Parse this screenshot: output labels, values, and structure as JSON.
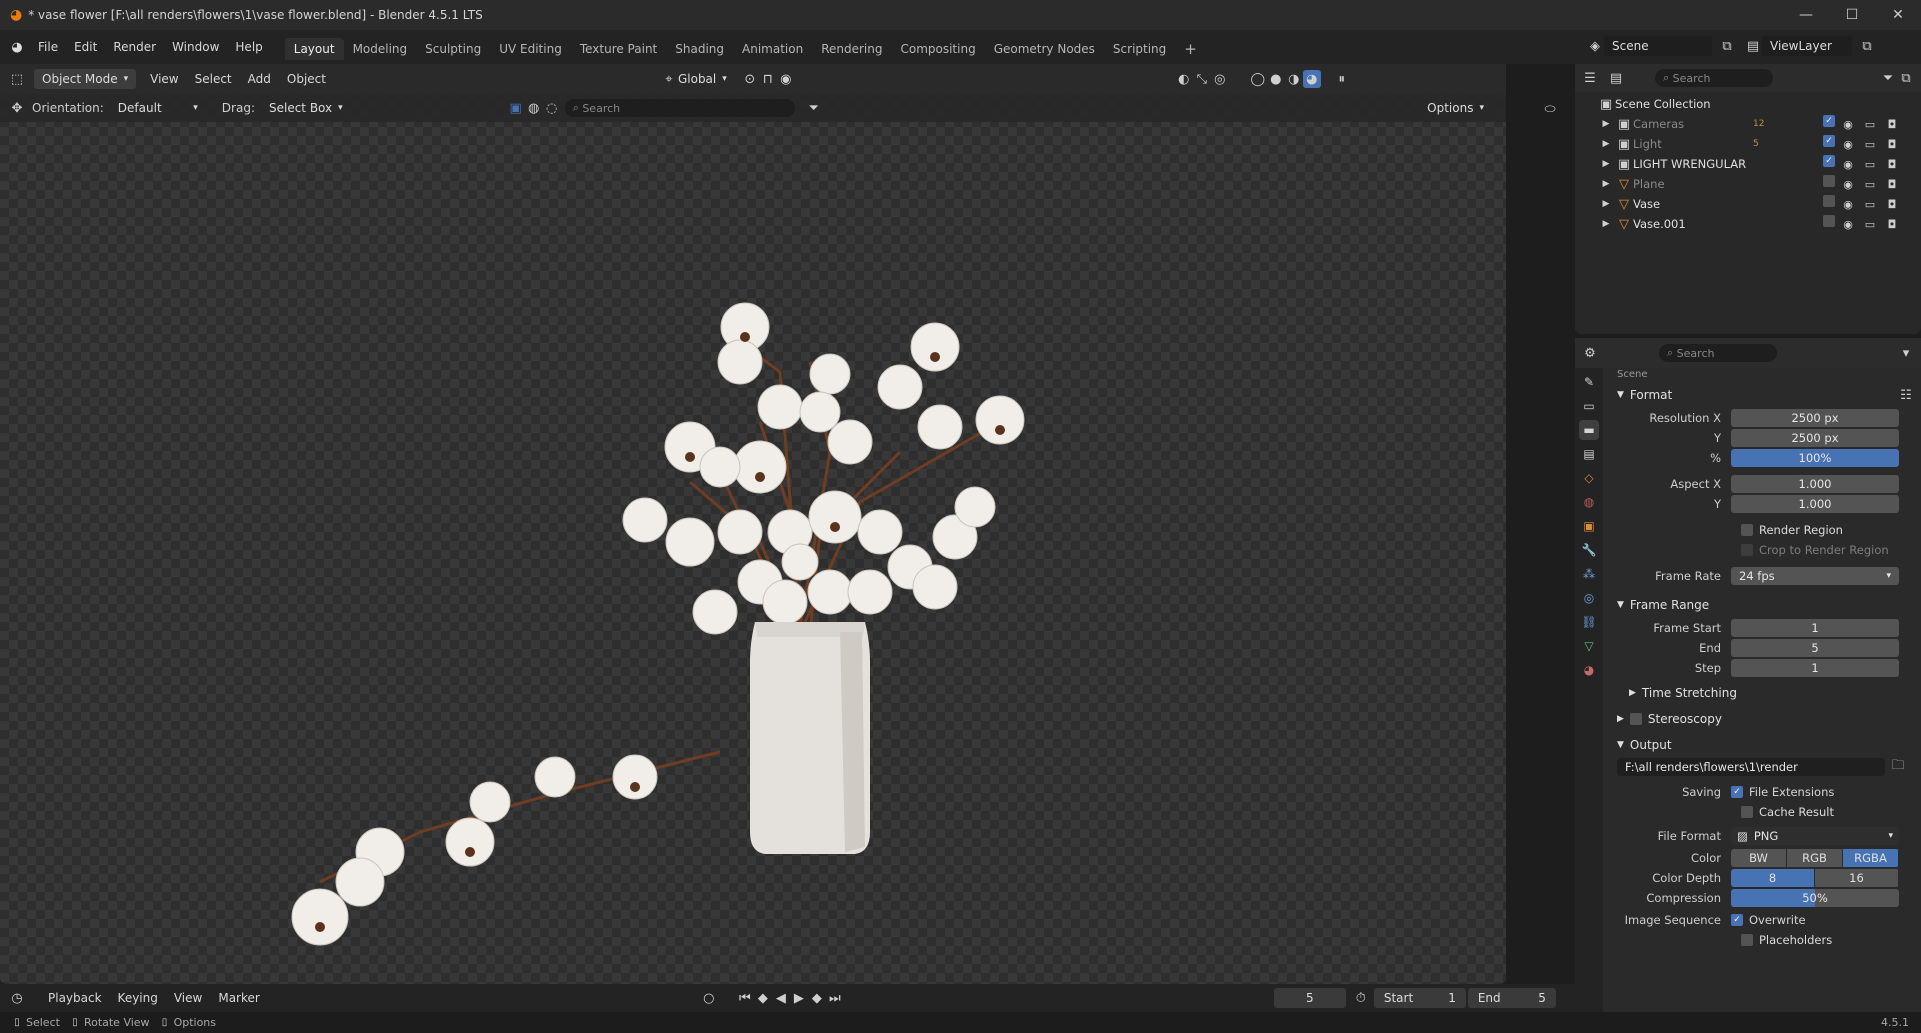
{
  "window": {
    "title": "* vase flower [F:\\all renders\\flowers\\1\\vase flower.blend] - Blender 4.5.1 LTS",
    "minimize": "—",
    "maximize": "☐",
    "close": "✕"
  },
  "menu": [
    "File",
    "Edit",
    "Render",
    "Window",
    "Help"
  ],
  "workspaces": [
    "Layout",
    "Modeling",
    "Sculpting",
    "UV Editing",
    "Texture Paint",
    "Shading",
    "Animation",
    "Rendering",
    "Compositing",
    "Geometry Nodes",
    "Scripting"
  ],
  "active_workspace": "Layout",
  "scene_selector": {
    "scene": "Scene",
    "view_layer": "ViewLayer"
  },
  "viewport_header": {
    "mode": "Object Mode",
    "menus": [
      "View",
      "Select",
      "Add",
      "Object"
    ],
    "transform": "Global"
  },
  "tool_settings": {
    "orientation_label": "Orientation:",
    "orientation": "Default",
    "drag_label": "Drag:",
    "drag": "Select Box",
    "search_placeholder": "Search",
    "options": "Options"
  },
  "outliner": {
    "search_placeholder": "Search",
    "root": "Scene Collection",
    "items": [
      {
        "name": "Cameras",
        "type": "collection",
        "badge": "12",
        "dim": true
      },
      {
        "name": "Light",
        "type": "collection",
        "badge": "5",
        "dim": true
      },
      {
        "name": "LIGHT WRENGULAR",
        "type": "collection",
        "badge": "",
        "dim": false
      },
      {
        "name": "Plane",
        "type": "mesh",
        "badge": "",
        "dim": true
      },
      {
        "name": "Vase",
        "type": "mesh",
        "badge": "",
        "dim": false
      },
      {
        "name": "Vase.001",
        "type": "mesh",
        "badge": "",
        "dim": false
      }
    ]
  },
  "properties": {
    "search_placeholder": "Search",
    "context": "Scene",
    "format": {
      "title": "Format",
      "resolution_x_label": "Resolution X",
      "resolution_x": "2500 px",
      "resolution_y_label": "Y",
      "resolution_y": "2500 px",
      "percent_label": "%",
      "percent": "100%",
      "aspect_x_label": "Aspect X",
      "aspect_x": "1.000",
      "aspect_y_label": "Y",
      "aspect_y": "1.000",
      "render_region": "Render Region",
      "crop": "Crop to Render Region",
      "frame_rate_label": "Frame Rate",
      "frame_rate": "24 fps"
    },
    "frame_range": {
      "title": "Frame Range",
      "start_label": "Frame Start",
      "start": "1",
      "end_label": "End",
      "end": "5",
      "step_label": "Step",
      "step": "1",
      "time_stretching": "Time Stretching"
    },
    "stereoscopy": "Stereoscopy",
    "output": {
      "title": "Output",
      "path": "F:\\all renders\\flowers\\1\\render",
      "saving_label": "Saving",
      "file_extensions": "File Extensions",
      "cache_result": "Cache Result",
      "file_format_label": "File Format",
      "file_format": "PNG",
      "color_label": "Color",
      "color_options": [
        "BW",
        "RGB",
        "RGBA"
      ],
      "color_selected": "RGBA",
      "depth_label": "Color Depth",
      "depth_options": [
        "8",
        "16"
      ],
      "depth_selected": "8",
      "compression_label": "Compression",
      "compression": "50%",
      "compression_value": 0.5,
      "sequence_label": "Image Sequence",
      "overwrite": "Overwrite",
      "placeholders": "Placeholders"
    }
  },
  "timeline": {
    "menus": [
      "Playback",
      "Keying",
      "View",
      "Marker"
    ],
    "current_frame": "5",
    "start_label": "Start",
    "start": "1",
    "end_label": "End",
    "end": "5"
  },
  "statusbar": {
    "select": "Select",
    "rotate": "Rotate View",
    "options": "Options",
    "version": "4.5.1"
  },
  "colors": {
    "accent": "#4772b3",
    "blender_orange": "#e87d0d",
    "background": "#1d1d1d"
  }
}
